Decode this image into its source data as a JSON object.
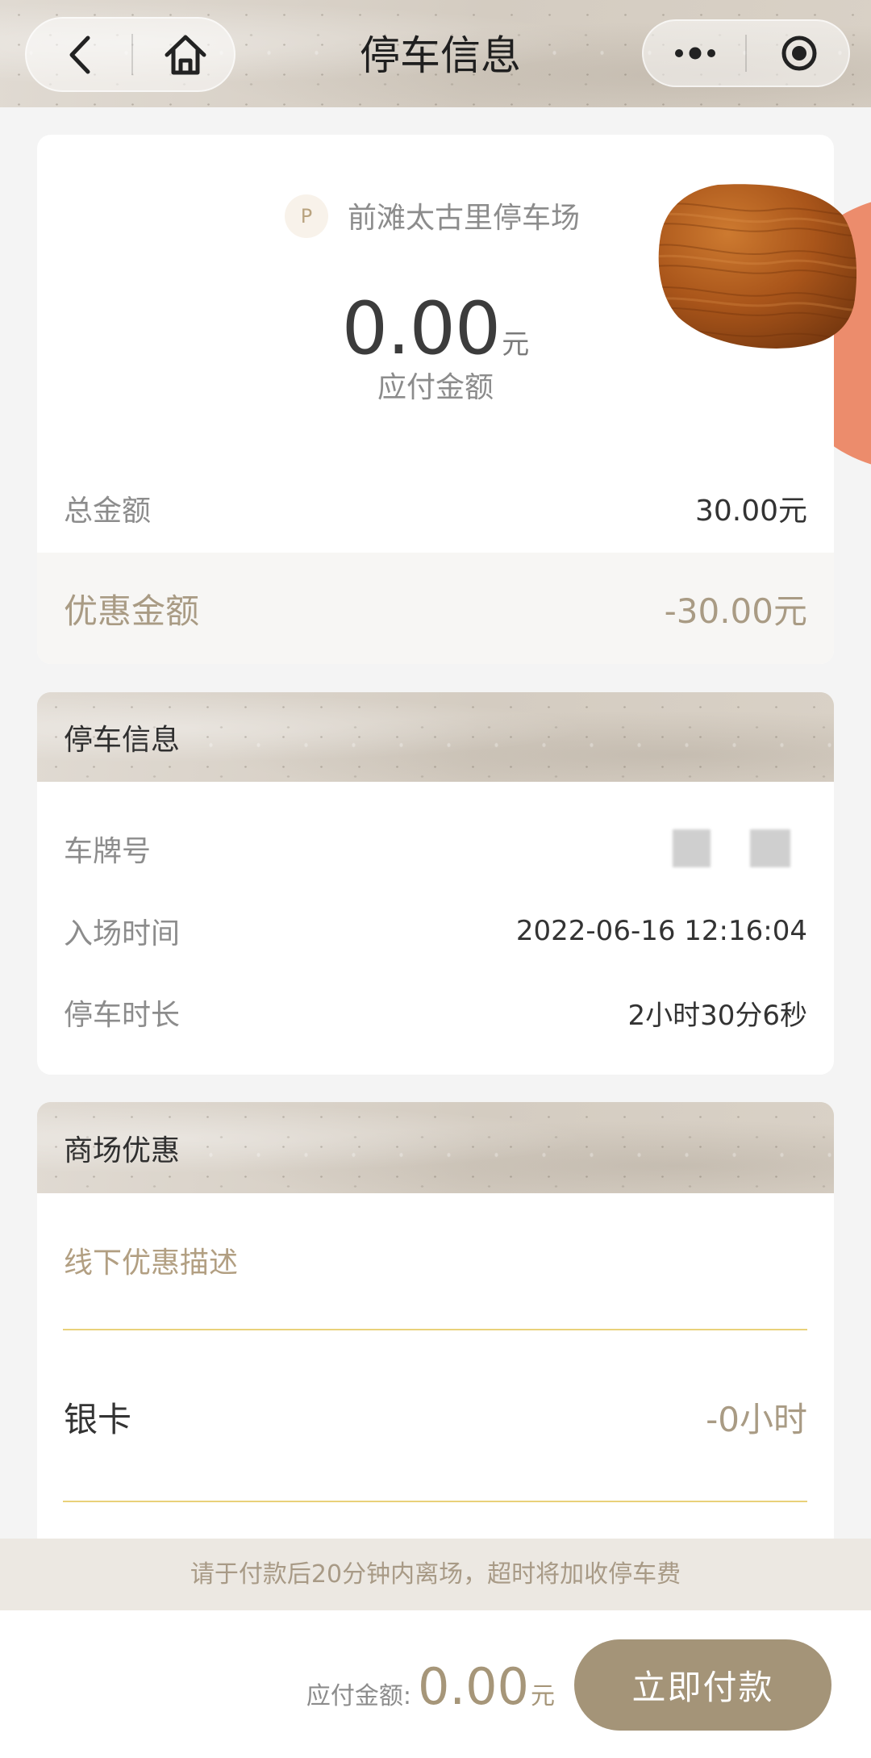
{
  "header": {
    "title": "停车信息",
    "back_icon": "back-arrow-icon",
    "home_icon": "home-icon",
    "more_icon": "more-dots-icon",
    "close_icon": "close-target-icon"
  },
  "summary": {
    "lot_badge": "P",
    "lot_name": "前滩太古里停车场",
    "amount_due": "0.00",
    "amount_unit": "元",
    "amount_due_label": "应付金额",
    "total_label": "总金额",
    "total_value": "30.00元",
    "discount_label": "优惠金额",
    "discount_value": "-30.00元"
  },
  "parking_info": {
    "title": "停车信息",
    "plate_label": "车牌号",
    "entry_label": "入场时间",
    "entry_value": "2022-06-16 12:16:04",
    "duration_label": "停车时长",
    "duration_value": "2小时30分6秒"
  },
  "mall_discount": {
    "title": "商场优惠",
    "offline_description_placeholder": "线下优惠描述",
    "tier_label": "银卡",
    "tier_value": "-0小时"
  },
  "notice": "请于付款后20分钟内离场，超时将加收停车费",
  "footer": {
    "due_label": "应付金额:",
    "due_amount": "0.00",
    "due_unit": "元",
    "pay_button": "立即付款"
  },
  "colors": {
    "accent": "#a49478",
    "discount_text": "#a99b84",
    "divider_yellow": "#e9d17a",
    "decor_orange": "#ec8c6c",
    "page_background": "#f4f4f4"
  }
}
